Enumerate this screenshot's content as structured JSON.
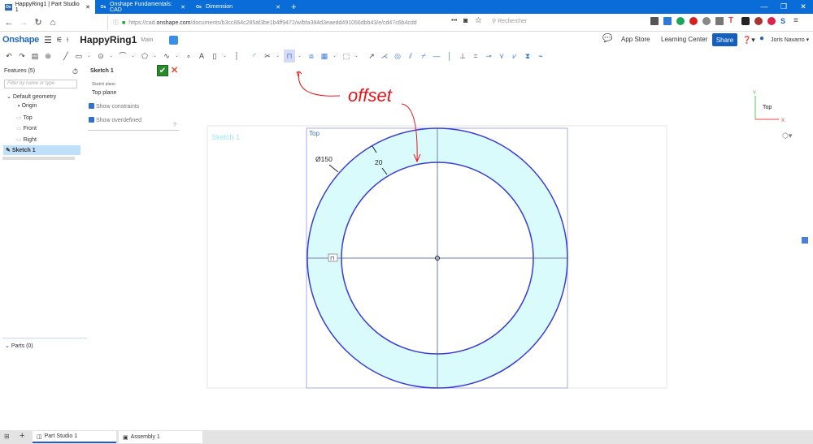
{
  "browser": {
    "tabs": [
      {
        "label": "HappyRing1 | Part Studio 1",
        "active": true
      },
      {
        "label": "Onshape Fundamentals: CAD",
        "active": false
      },
      {
        "label": "Dimension",
        "active": false
      }
    ],
    "new_tab": "+",
    "url_prefix": "https://cad.",
    "url_domain": "onshape.com",
    "url_path": "/documents/b3cc864c285af3be1b4ff9472/w/bfa384d3eaedd491056dbb43/e/cd47c6b4cdd",
    "url_more": "•••",
    "search_placeholder": "Rechercher"
  },
  "app": {
    "brand": "Onshape",
    "doc_name": "HappyRing1",
    "branch": "Main",
    "app_store": "App Store",
    "learning_center": "Learning Center",
    "share": "Share",
    "user": "Joris Navarro"
  },
  "toolbar": {
    "icons": [
      "undo",
      "redo",
      "clipboard",
      "variable",
      "line",
      "rectangle",
      "dd",
      "circle",
      "dd",
      "arc",
      "dd",
      "polygon",
      "dd",
      "spline",
      "dd",
      "point",
      "text",
      "image",
      "dd",
      "construction",
      "fillet",
      "trim",
      "dd",
      "offset",
      "dd",
      "mirror",
      "pattern",
      "dd",
      "transform",
      "dd",
      "dimension",
      "coincident",
      "concentric",
      "parallel",
      "tangent",
      "horizontal",
      "vertical",
      "perpendicular",
      "equal",
      "midpoint",
      "normal",
      "pierce",
      "symmetric",
      "fix"
    ],
    "selected": "offset"
  },
  "features": {
    "title": "Features (5)",
    "filter_placeholder": "Filter by name or type",
    "default_geometry": "Default geometry",
    "items": [
      "Origin",
      "Top",
      "Front",
      "Right"
    ],
    "sketch": "Sketch 1",
    "parts": "Parts (0)"
  },
  "sketch_panel": {
    "title": "Sketch 1",
    "plane_label": "Sketch plane",
    "plane_value": "Top plane",
    "show_constraints": "Show constraints",
    "show_overdefined": "Show overdefined",
    "constraints_checked": true,
    "overdefined_checked": true
  },
  "canvas": {
    "sketch_label": "Sketch 1",
    "plane_label": "Top",
    "diameter_dim": "Ø150",
    "offset_dim": "20",
    "annotation": "offset",
    "offset_marker": "⊓",
    "triad": {
      "y": "Y",
      "x": "X",
      "view": "Top"
    }
  },
  "bottom_tabs": [
    "Part Studio 1",
    "Assembly 1"
  ],
  "colors": {
    "accent": "#0a6cd6",
    "sketch_line": "#3b3bd6",
    "sketch_fill": "#d9fbfb",
    "annotation": "#e8141a"
  }
}
